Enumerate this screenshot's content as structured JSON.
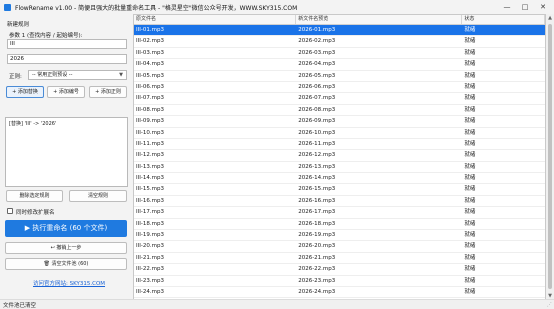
{
  "window": {
    "title": "FlowRename v1.00 - 简便且强大的批量重命名工具 - \"格灵星空\"微信公众号开发，WWW.SKY315.COM",
    "minimize_icon": "minimize-icon",
    "maximize_icon": "maximize-icon",
    "close_icon": "close-icon"
  },
  "left_panel": {
    "new_rule_label": "新建规则",
    "param1_label": "参数 1 (查找内容 / 起始编号):",
    "param1_value": "III",
    "param2_value": "2026",
    "regex_label": "正则:",
    "regex_select": "-- 常用正则预设 --",
    "add_replace_label": "+ 添加替换",
    "add_number_label": "+ 添加编号",
    "add_regex_label": "+ 添加正则",
    "rules_text": "[替换] 'III' -> '2026'",
    "delete_rule_label": "删除选定规则",
    "clear_rules_label": "清空规则",
    "modify_ext_label": "同时修改扩展名",
    "execute_label": "▶ 执行重命名 (60 个文件)",
    "undo_label": "↩ 撤销上一步",
    "clear_list_label": "🗑 清空文件池 (60)",
    "website_link": "访问官方网站: SKY315.COM"
  },
  "table": {
    "columns": [
      "原文件名",
      "新文件名预览",
      "状态"
    ],
    "rows": [
      [
        "III-01.mp3",
        "2026-01.mp3",
        "就绪"
      ],
      [
        "III-02.mp3",
        "2026-02.mp3",
        "就绪"
      ],
      [
        "III-03.mp3",
        "2026-03.mp3",
        "就绪"
      ],
      [
        "III-04.mp3",
        "2026-04.mp3",
        "就绪"
      ],
      [
        "III-05.mp3",
        "2026-05.mp3",
        "就绪"
      ],
      [
        "III-06.mp3",
        "2026-06.mp3",
        "就绪"
      ],
      [
        "III-07.mp3",
        "2026-07.mp3",
        "就绪"
      ],
      [
        "III-08.mp3",
        "2026-08.mp3",
        "就绪"
      ],
      [
        "III-09.mp3",
        "2026-09.mp3",
        "就绪"
      ],
      [
        "III-10.mp3",
        "2026-10.mp3",
        "就绪"
      ],
      [
        "III-11.mp3",
        "2026-11.mp3",
        "就绪"
      ],
      [
        "III-12.mp3",
        "2026-12.mp3",
        "就绪"
      ],
      [
        "III-13.mp3",
        "2026-13.mp3",
        "就绪"
      ],
      [
        "III-14.mp3",
        "2026-14.mp3",
        "就绪"
      ],
      [
        "III-15.mp3",
        "2026-15.mp3",
        "就绪"
      ],
      [
        "III-16.mp3",
        "2026-16.mp3",
        "就绪"
      ],
      [
        "III-17.mp3",
        "2026-17.mp3",
        "就绪"
      ],
      [
        "III-18.mp3",
        "2026-18.mp3",
        "就绪"
      ],
      [
        "III-19.mp3",
        "2026-19.mp3",
        "就绪"
      ],
      [
        "III-20.mp3",
        "2026-20.mp3",
        "就绪"
      ],
      [
        "III-21.mp3",
        "2026-21.mp3",
        "就绪"
      ],
      [
        "III-22.mp3",
        "2026-22.mp3",
        "就绪"
      ],
      [
        "III-23.mp3",
        "2026-23.mp3",
        "就绪"
      ],
      [
        "III-24.mp3",
        "2026-24.mp3",
        "就绪"
      ],
      [
        "III-25.mp3",
        "2026-25.mp3",
        "就绪"
      ]
    ]
  },
  "status_bar": {
    "text": "文件池已清空"
  },
  "colors": {
    "accent": "#1f7ae0",
    "selected_row": "#1a73e8",
    "link": "#1a63d6"
  }
}
